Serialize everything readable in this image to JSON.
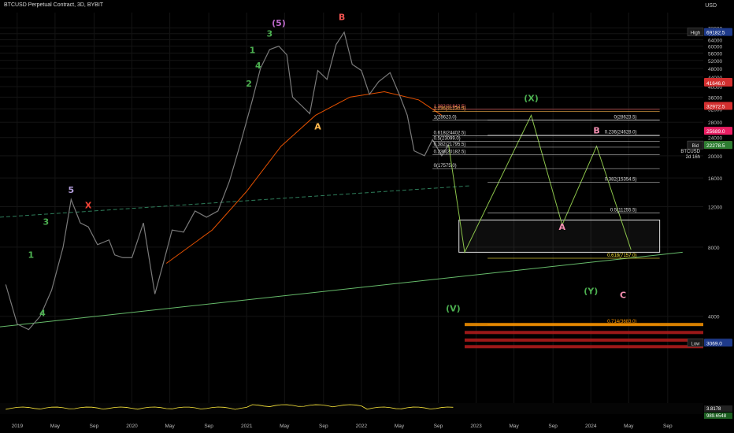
{
  "header": {
    "title": "BTCUSD Perpetual Contract, 3D, BYBIT"
  },
  "chart_data": {
    "type": "line",
    "currency": "USD",
    "ylim": [
      1500,
      84000
    ],
    "y_scale": "log",
    "y_ticks": [
      72000,
      68000,
      64000,
      60000,
      56000,
      52000,
      48000,
      44000,
      40000,
      36000,
      32000,
      28000,
      24000,
      20000,
      16000,
      12000,
      8000,
      4000
    ],
    "x_ticks": [
      {
        "label": "2019",
        "t": 2019.0
      },
      {
        "label": "May",
        "t": 2019.33
      },
      {
        "label": "Sep",
        "t": 2019.67
      },
      {
        "label": "2020",
        "t": 2020.0
      },
      {
        "label": "May",
        "t": 2020.33
      },
      {
        "label": "Sep",
        "t": 2020.67
      },
      {
        "label": "2021",
        "t": 2021.0
      },
      {
        "label": "May",
        "t": 2021.33
      },
      {
        "label": "Sep",
        "t": 2021.67
      },
      {
        "label": "2022",
        "t": 2022.0
      },
      {
        "label": "May",
        "t": 2022.33
      },
      {
        "label": "Sep",
        "t": 2022.67
      },
      {
        "label": "2023",
        "t": 2023.0
      },
      {
        "label": "May",
        "t": 2023.33
      },
      {
        "label": "Sep",
        "t": 2023.67
      },
      {
        "label": "2024",
        "t": 2024.0
      },
      {
        "label": "May",
        "t": 2024.33
      },
      {
        "label": "Sep",
        "t": 2024.67
      }
    ],
    "series": [
      {
        "color": "#7a7a7a",
        "points": [
          [
            2018.9,
            5500
          ],
          [
            2019.0,
            3700
          ],
          [
            2019.1,
            3500
          ],
          [
            2019.2,
            4000
          ],
          [
            2019.3,
            5200
          ],
          [
            2019.4,
            8000
          ],
          [
            2019.47,
            12900
          ],
          [
            2019.55,
            10200
          ],
          [
            2019.62,
            9800
          ],
          [
            2019.7,
            8200
          ],
          [
            2019.8,
            8600
          ],
          [
            2019.85,
            7400
          ],
          [
            2019.92,
            7200
          ],
          [
            2020.0,
            7200
          ],
          [
            2020.1,
            10200
          ],
          [
            2020.2,
            5000
          ],
          [
            2020.28,
            7000
          ],
          [
            2020.35,
            9500
          ],
          [
            2020.45,
            9300
          ],
          [
            2020.55,
            11500
          ],
          [
            2020.65,
            10800
          ],
          [
            2020.75,
            11500
          ],
          [
            2020.85,
            15500
          ],
          [
            2020.95,
            23000
          ],
          [
            2021.05,
            35000
          ],
          [
            2021.12,
            48000
          ],
          [
            2021.2,
            58000
          ],
          [
            2021.28,
            60000
          ],
          [
            2021.35,
            55000
          ],
          [
            2021.4,
            36000
          ],
          [
            2021.48,
            33000
          ],
          [
            2021.55,
            30500
          ],
          [
            2021.62,
            47000
          ],
          [
            2021.7,
            43000
          ],
          [
            2021.78,
            61000
          ],
          [
            2021.85,
            69000
          ],
          [
            2021.92,
            50000
          ],
          [
            2022.0,
            47000
          ],
          [
            2022.07,
            37000
          ],
          [
            2022.15,
            42000
          ],
          [
            2022.25,
            46000
          ],
          [
            2022.33,
            37000
          ],
          [
            2022.4,
            30000
          ],
          [
            2022.46,
            21000
          ],
          [
            2022.55,
            20000
          ],
          [
            2022.62,
            23500
          ],
          [
            2022.7,
            20000
          ],
          [
            2022.76,
            22300
          ]
        ]
      }
    ],
    "levels": [
      {
        "label": "1.382(31842.5)",
        "value": 31842.5,
        "color": "#ff6666"
      },
      {
        "label": "1.236(31230.5)",
        "value": 31230.5,
        "color": "#ffb74d"
      },
      {
        "label": "1(28623.0)",
        "value": 28623.0,
        "color": "#e0e0e0"
      },
      {
        "label": "0.618(24402.5)",
        "value": 24402.5,
        "color": "#e0e0e0"
      },
      {
        "label": "0.5(23099.0)",
        "value": 23099.0,
        "color": "#e0e0e0"
      },
      {
        "label": "0.382(21795.5)",
        "value": 21795.5,
        "color": "#e0e0e0"
      },
      {
        "label": "0.236(20182.5)",
        "value": 20182.5,
        "color": "#e0e0e0"
      },
      {
        "label": "0(17575.0)",
        "value": 17575.0,
        "color": "#e0e0e0"
      },
      {
        "label": "0(28623.5)",
        "value": 28623.5,
        "color": "#e0e0e0"
      },
      {
        "label": "0.236(24628.0)",
        "value": 24628.0,
        "color": "#e0e0e0"
      },
      {
        "label": "0.382(15354.5)",
        "value": 15354.5,
        "color": "#e0e0e0"
      },
      {
        "label": "0.5(11255.5)",
        "value": 11255.5,
        "color": "#e0e0e0"
      },
      {
        "label": "0.618(7157.0)",
        "value": 7157.0,
        "color": "#ffeb3b"
      },
      {
        "label": "0.714(3683.0)",
        "value": 3683.0,
        "color": "#ff9800"
      }
    ],
    "wave_labels": [
      {
        "t": 2019.12,
        "v": 7200,
        "text": "1",
        "color": "#4caf50"
      },
      {
        "t": 2019.25,
        "v": 10000,
        "text": "3",
        "color": "#4caf50"
      },
      {
        "t": 2019.22,
        "v": 4000,
        "text": "4",
        "color": "#4caf50"
      },
      {
        "t": 2019.47,
        "v": 13800,
        "text": "5",
        "color": "#b39ddb"
      },
      {
        "t": 2019.62,
        "v": 11800,
        "text": "X",
        "color": "#f44336"
      },
      {
        "t": 2021.2,
        "v": 66000,
        "text": "3",
        "color": "#4caf50"
      },
      {
        "t": 2021.28,
        "v": 73500,
        "text": "(5)",
        "color": "#ba68c8"
      },
      {
        "t": 2021.05,
        "v": 56000,
        "text": "1",
        "color": "#4caf50"
      },
      {
        "t": 2021.1,
        "v": 48000,
        "text": "4",
        "color": "#4caf50"
      },
      {
        "t": 2021.02,
        "v": 40000,
        "text": "2",
        "color": "#4caf50"
      },
      {
        "t": 2021.83,
        "v": 78000,
        "text": "B",
        "color": "#ef5350"
      },
      {
        "t": 2021.62,
        "v": 26000,
        "text": "A",
        "color": "#ffb74d"
      },
      {
        "t": 2022.8,
        "v": 4200,
        "text": "(V)",
        "color": "#4caf50"
      },
      {
        "t": 2023.48,
        "v": 34500,
        "text": "(X)",
        "color": "#4caf50"
      },
      {
        "t": 2023.75,
        "v": 9500,
        "text": "A",
        "color": "#f48fb1"
      },
      {
        "t": 2024.05,
        "v": 25000,
        "text": "B",
        "color": "#f48fb1"
      },
      {
        "t": 2024.0,
        "v": 5000,
        "text": "(Y)",
        "color": "#4caf50"
      },
      {
        "t": 2024.28,
        "v": 4800,
        "text": "C",
        "color": "#f48fb1"
      }
    ],
    "price_tags": [
      {
        "label": "69182.5",
        "value": 69182.5,
        "bg": "#1e3a8a",
        "name": "High"
      },
      {
        "label": "41929.0",
        "value": 41929.0,
        "bg": "#d32f2f",
        "name": ""
      },
      {
        "label": "41646.0",
        "value": 41646.0,
        "bg": "#d32f2f",
        "name": ""
      },
      {
        "label": "32972.5",
        "value": 32972.5,
        "bg": "#d32f2f",
        "name": ""
      },
      {
        "label": "25689.0",
        "value": 25689.0,
        "bg": "#e91e63",
        "name": ""
      },
      {
        "label": "22279.0",
        "value": 22279.0,
        "bg": "#d32f2f",
        "name": "Ask"
      },
      {
        "label": "22278.5",
        "value": 22278.5,
        "bg": "#2e7d32",
        "name": "Bid"
      },
      {
        "label": "3069.0",
        "value": 3069.0,
        "bg": "#1e3a8a",
        "name": "Low"
      }
    ],
    "price_panel": {
      "symbol": "BTCUSD",
      "price": "22279.0",
      "countdown": "2d 16h"
    },
    "indicator_values": [
      "3.8178",
      "989.6548"
    ]
  }
}
